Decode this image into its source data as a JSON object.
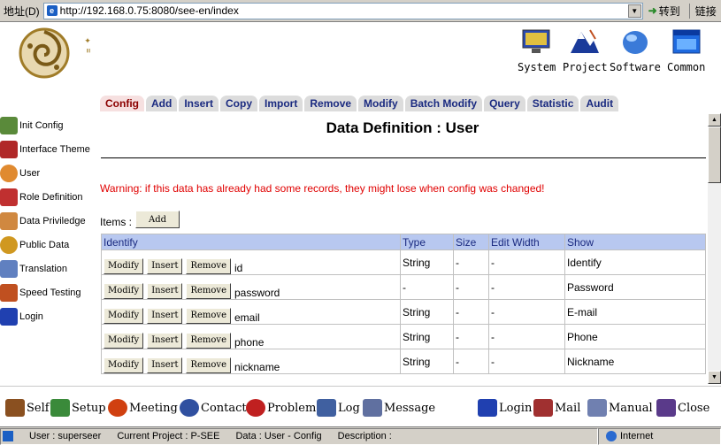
{
  "browser": {
    "address_label": "地址(D)",
    "url": "http://192.168.0.75:8080/see-en/index",
    "go_label": "转到",
    "links_label": "链接"
  },
  "header": {
    "top_nav": [
      {
        "label": "System",
        "icon": "monitor-icon"
      },
      {
        "label": "Project",
        "icon": "mountain-icon"
      },
      {
        "label": "Software",
        "icon": "mouse-icon"
      },
      {
        "label": "Common",
        "icon": "window-icon"
      }
    ]
  },
  "tabs": [
    {
      "label": "Config",
      "active": true
    },
    {
      "label": "Add"
    },
    {
      "label": "Insert"
    },
    {
      "label": "Copy"
    },
    {
      "label": "Import"
    },
    {
      "label": "Remove"
    },
    {
      "label": "Modify"
    },
    {
      "label": "Batch Modify"
    },
    {
      "label": "Query"
    },
    {
      "label": "Statistic"
    },
    {
      "label": "Audit"
    }
  ],
  "left_nav": [
    {
      "label": "Init Config",
      "icon": "toolbox-icon",
      "color": "#5a8a3a"
    },
    {
      "label": "Interface Theme",
      "icon": "theme-icon",
      "color": "#b02828"
    },
    {
      "label": "User",
      "icon": "user-face-icon",
      "color": "#e08a30"
    },
    {
      "label": "Role Definition",
      "icon": "roles-icon",
      "color": "#c03030"
    },
    {
      "label": "Data Priviledge",
      "icon": "hand-icon",
      "color": "#d08840"
    },
    {
      "label": "Public Data",
      "icon": "key-icon",
      "color": "#d09820"
    },
    {
      "label": "Translation",
      "icon": "pen-icon",
      "color": "#6080c0"
    },
    {
      "label": "Speed Testing",
      "icon": "speed-icon",
      "color": "#c05020"
    },
    {
      "label": "Login",
      "icon": "door-icon",
      "color": "#2040b0"
    }
  ],
  "main": {
    "title": "Data Definition : User",
    "warning": "Warning: if this data has already had some records, they might lose when config was changed!",
    "items_label": "Items :",
    "add_label": "Add",
    "columns": [
      "Identify",
      "Type",
      "Size",
      "Edit Width",
      "Show"
    ],
    "row_buttons": {
      "modify": "Modify",
      "insert": "Insert",
      "remove": "Remove"
    },
    "rows": [
      {
        "identify": "id",
        "type": "String",
        "size": "-",
        "edit_width": "-",
        "show": "Identify"
      },
      {
        "identify": "password",
        "type": "-",
        "size": "-",
        "edit_width": "-",
        "show": "Password"
      },
      {
        "identify": "email",
        "type": "String",
        "size": "-",
        "edit_width": "-",
        "show": "E-mail"
      },
      {
        "identify": "phone",
        "type": "String",
        "size": "-",
        "edit_width": "-",
        "show": "Phone"
      },
      {
        "identify": "nickname",
        "type": "String",
        "size": "-",
        "edit_width": "-",
        "show": "Nickname"
      }
    ]
  },
  "bottom_nav": [
    {
      "label": "Self",
      "icon": "house-icon",
      "color": "#8a5020"
    },
    {
      "label": "Setup",
      "icon": "setup-icon",
      "color": "#3a8a3a"
    },
    {
      "label": "Meeting",
      "icon": "meeting-icon",
      "color": "#d04010"
    },
    {
      "label": "Contact",
      "icon": "contact-icon",
      "color": "#3050a0"
    },
    {
      "label": "Problem",
      "icon": "question-icon",
      "color": "#c02020"
    },
    {
      "label": "Log",
      "icon": "log-icon",
      "color": "#4060a0"
    },
    {
      "label": "Message",
      "icon": "message-icon",
      "color": "#6070a0"
    },
    {
      "label": "Login",
      "icon": "door-icon",
      "color": "#2040b0"
    },
    {
      "label": "Mail",
      "icon": "mail-icon",
      "color": "#a03030"
    },
    {
      "label": "Manual",
      "icon": "manual-icon",
      "color": "#7080b0"
    },
    {
      "label": "Close",
      "icon": "close-icon",
      "color": "#5a3a8a"
    }
  ],
  "status": {
    "user": "User : superseer",
    "project": "Current Project : P-SEE",
    "data": "Data : User - Config",
    "description": "Description :",
    "zone": "Internet"
  }
}
